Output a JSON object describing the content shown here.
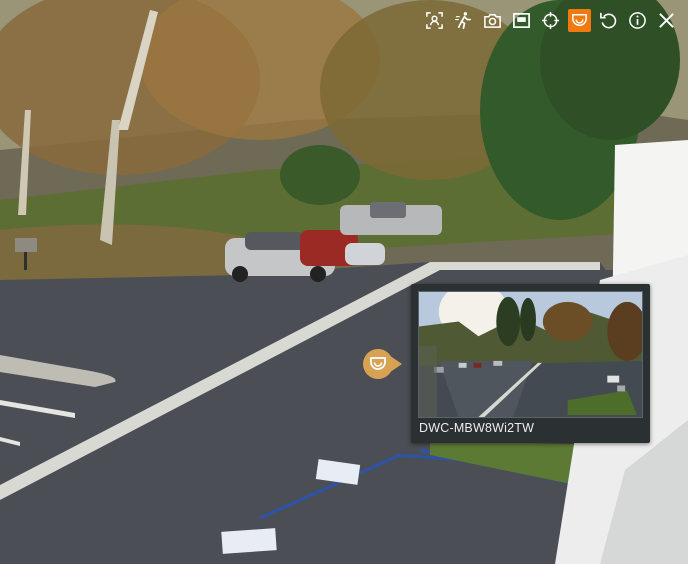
{
  "toolbar": {
    "buttons": [
      {
        "icon": "face-detect-icon",
        "active": false
      },
      {
        "icon": "motion-person-icon",
        "active": false
      },
      {
        "icon": "camera-snapshot-icon",
        "active": false
      },
      {
        "icon": "picture-in-picture-icon",
        "active": false
      },
      {
        "icon": "crosshair-icon",
        "active": false
      },
      {
        "icon": "dome-camera-icon",
        "active": true
      },
      {
        "icon": "refresh-icon",
        "active": false
      },
      {
        "icon": "info-icon",
        "active": false
      },
      {
        "icon": "close-icon",
        "active": false
      }
    ],
    "active_color": "#f07a10"
  },
  "camera_marker": {
    "icon": "dome-camera-icon",
    "color": "#d8a255"
  },
  "popup": {
    "camera_name": "DWC-MBW8Wi2TW"
  }
}
